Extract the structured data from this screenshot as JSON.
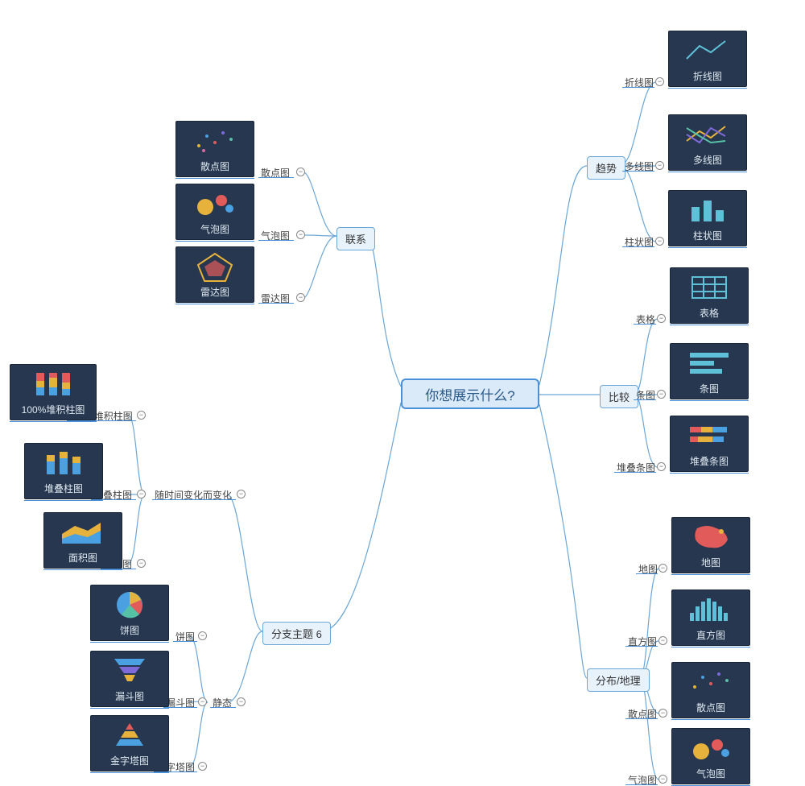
{
  "center": "你想展示什么?",
  "branches": {
    "relation": {
      "label": "联系",
      "children": [
        {
          "label": "散点图",
          "card": "散点图",
          "icon": "scatter"
        },
        {
          "label": "气泡图",
          "card": "气泡图",
          "icon": "bubble"
        },
        {
          "label": "雷达图",
          "card": "雷达图",
          "icon": "radar"
        }
      ]
    },
    "trend": {
      "label": "趋势",
      "children": [
        {
          "label": "折线图",
          "card": "折线图",
          "icon": "line"
        },
        {
          "label": "多线图",
          "card": "多线图",
          "icon": "multiline"
        },
        {
          "label": "柱状图",
          "card": "柱状图",
          "icon": "bar"
        }
      ]
    },
    "compare": {
      "label": "比较",
      "children": [
        {
          "label": "表格",
          "card": "表格",
          "icon": "table"
        },
        {
          "label": "条图",
          "card": "条图",
          "icon": "hbar"
        },
        {
          "label": "堆叠条图",
          "card": "堆叠条图",
          "icon": "stackhbar"
        }
      ]
    },
    "distribution": {
      "label": "分布/地理",
      "children": [
        {
          "label": "地图",
          "card": "地图",
          "icon": "map"
        },
        {
          "label": "直方图",
          "card": "直方图",
          "icon": "histogram"
        },
        {
          "label": "散点图",
          "card": "散点图",
          "icon": "scatter"
        },
        {
          "label": "气泡图",
          "card": "气泡图",
          "icon": "bubble"
        }
      ]
    },
    "sub6": {
      "label": "分支主题 6",
      "children": [
        {
          "label": "随时间变化而变化",
          "sub": [
            {
              "label": "100%堆积柱图",
              "card": "100%堆积柱图",
              "icon": "stack100"
            },
            {
              "label": "堆叠柱图",
              "card": "堆叠柱图",
              "icon": "stackbar"
            },
            {
              "label": "面积图",
              "card": "面积图",
              "icon": "area"
            }
          ]
        },
        {
          "label": "静态",
          "sub": [
            {
              "label": "饼图",
              "card": "饼图",
              "icon": "pie"
            },
            {
              "label": "漏斗图",
              "card": "漏斗图",
              "icon": "funnel"
            },
            {
              "label": "金字塔图",
              "card": "金字塔图",
              "icon": "pyramid"
            }
          ]
        }
      ]
    }
  }
}
